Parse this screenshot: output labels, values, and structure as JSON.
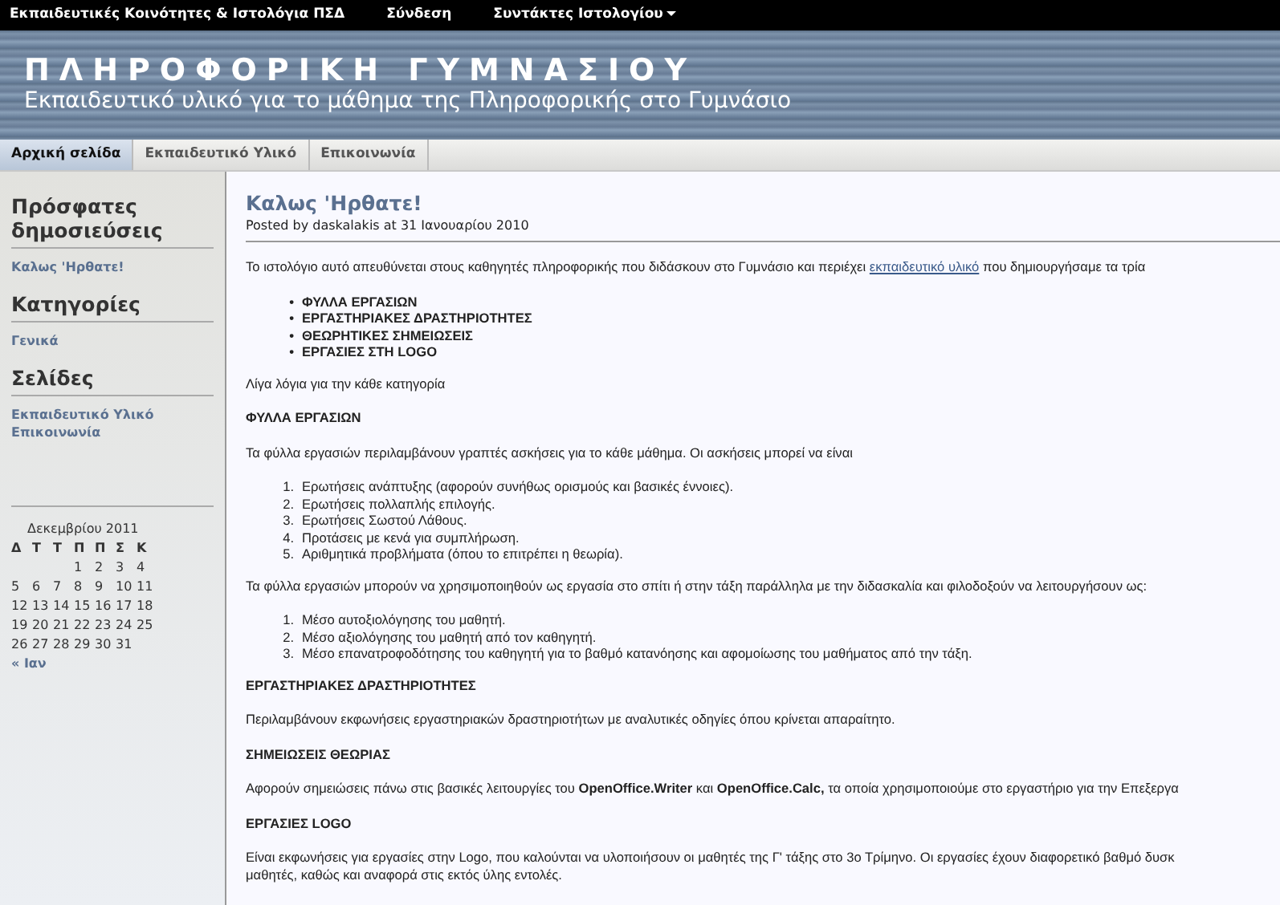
{
  "top_bar": {
    "items": [
      {
        "label": "Εκπαιδευτικές Κοινότητες & Ιστολόγια ΠΣΔ",
        "kind": "title"
      },
      {
        "label": "Σύνδεση",
        "kind": "link"
      },
      {
        "label": "Συντάκτες Ιστολογίου",
        "kind": "menu"
      }
    ]
  },
  "header": {
    "title": "ΠΛΗΡΟΦΟΡΙΚΗ ΓΥΜΝΑΣΙΟΥ",
    "subtitle": "Εκπαιδευτικό υλικό για το μάθημα της Πληροφορικής στο Γυμνάσιο"
  },
  "tabs": [
    {
      "label": "Αρχική σελίδα",
      "selected": true
    },
    {
      "label": "Εκπαιδευτικό Υλικό",
      "selected": false
    },
    {
      "label": "Επικοινωνία",
      "selected": false
    }
  ],
  "sidebar": {
    "sections": [
      {
        "title": "Πρόσφατες δημοσιεύσεις",
        "links": [
          "Καλως 'Ηρθατε!"
        ]
      },
      {
        "title": "Κατηγορίες",
        "links": [
          "Γενικά"
        ]
      },
      {
        "title": "Σελίδες",
        "links": [
          "Εκπαιδευτικό Υλικό",
          "Επικοινωνία"
        ]
      }
    ],
    "calendar": {
      "month": "Δεκεμβρίου 2011",
      "weekdays": [
        "Δ",
        "Τ",
        "Τ",
        "Π",
        "Π",
        "Σ",
        "Κ"
      ],
      "weeks": [
        [
          "1",
          "2",
          "3",
          "4"
        ],
        [
          "5",
          "6",
          "7",
          "8",
          "9",
          "10",
          "11"
        ],
        [
          "12",
          "13",
          "14",
          "15",
          "16",
          "17",
          "18"
        ],
        [
          "19",
          "20",
          "21",
          "22",
          "23",
          "24",
          "25"
        ],
        [
          "26",
          "27",
          "28",
          "29",
          "30",
          "31"
        ]
      ],
      "prev_link": "« Ιαν"
    }
  },
  "post": {
    "title": "Καλως 'Ηρθατε!",
    "byline": "Posted by daskalakis at 31 Ιανουαρίου 2010",
    "body": [
      {
        "kind": "paragraph",
        "parts": [
          {
            "text": "Το ιστολόγιο αυτό απευθύνεται στους καθηγητές πληροφορικής που διδάσκουν  στο Γυμνάσιο και περιέχει",
            "kind": "text"
          },
          {
            "text": "εκπαιδευτικό υλικό",
            "kind": "link"
          },
          {
            "text": "που δημιουργήσαμε τα τρία",
            "kind": "text"
          }
        ]
      },
      {
        "kind": "bullets",
        "items": [
          {
            "marker": "•",
            "text": "ΦΥΛΛΑ ΕΡΓΑΣΙΩΝ"
          },
          {
            "marker": "•",
            "text": "ΕΡΓΑΣΤΗΡΙΑΚΕΣ  ΔΡΑΣΤΗΡΙΟΤΗΤΕΣ"
          },
          {
            "marker": "•",
            "text": "ΘΕΩΡΗΤΙΚΕΣ ΣΗΜΕΙΩΣΕΙΣ"
          },
          {
            "marker": "•",
            "text": "ΕΡΓΑΣΙΕΣ ΣΤΗ LOGO"
          }
        ]
      },
      {
        "kind": "paragraph",
        "parts": [
          {
            "text": "Λίγα λόγια για την κάθε κατηγορία",
            "kind": "text"
          }
        ]
      },
      {
        "kind": "heading",
        "text": "ΦΥΛΛΑ ΕΡΓΑΣΙΩΝ"
      },
      {
        "kind": "paragraph",
        "parts": [
          {
            "text": "Τα φύλλα εργασιών περιλαμβάνουν γραπτές ασκήσεις για το κάθε μάθημα. Οι ασκήσεις μπορεί να είναι",
            "kind": "text"
          }
        ]
      },
      {
        "kind": "numbered",
        "items": [
          {
            "marker": "1.",
            "text": "Ερωτήσεις ανάπτυξης (αφορούν συνήθως ορισμούς και βασικές έννοιες)."
          },
          {
            "marker": "2.",
            "text": "Ερωτήσεις πολλαπλής επιλογής."
          },
          {
            "marker": "3.",
            "text": "Ερωτήσεις Σωστού Λάθους."
          },
          {
            "marker": "4.",
            "text": "Προτάσεις με κενά για συμπλήρωση."
          },
          {
            "marker": "5.",
            "text": "Αριθμητικά προβλήματα (όπου το επιτρέπει η θεωρία)."
          }
        ]
      },
      {
        "kind": "paragraph",
        "parts": [
          {
            "text": "Τα φύλλα εργασιών μπορούν να χρησιμοποιηθούν ως εργασία στο σπίτι ή στην τάξη παράλληλα με την διδασκαλία και φιλοδοξούν να λειτουργήσουν ως:",
            "kind": "text"
          }
        ]
      },
      {
        "kind": "numbered",
        "items": [
          {
            "marker": "1.",
            "text": "Μέσο αυτοξιολόγησης του μαθητή."
          },
          {
            "marker": "2.",
            "text": "Μέσο αξιολόγησης του μαθητή από τον καθηγητή."
          },
          {
            "marker": "3.",
            "text": "Μέσο επανατροφοδότησης του καθηγητή για το βαθμό κατανόησης και αφομοίωσης του μαθήματος από την τάξη."
          }
        ]
      },
      {
        "kind": "heading",
        "text": "ΕΡΓΑΣΤΗΡΙΑΚΕΣ ΔΡΑΣΤΗΡΙΟΤΗΤΕΣ"
      },
      {
        "kind": "paragraph",
        "parts": [
          {
            "text": "Περιλαμβάνουν εκφωνήσεις εργαστηριακών δραστηριοτήτων με αναλυτικές οδηγίες όπου κρίνεται απαραίτητο.",
            "kind": "text"
          }
        ]
      },
      {
        "kind": "heading",
        "text": "ΣΗΜΕΙΩΣΕΙΣ ΘΕΩΡΙΑΣ"
      },
      {
        "kind": "paragraph",
        "parts": [
          {
            "text": "Αφορούν σημειώσεις πάνω στις βασικές λειτουργίες του **OpenOffice.Writer** και **OpenOffice.Calc,** τα οποία χρησιμοποιούμε στο εργαστήριο για την Επεξεργα",
            "kind": "text"
          }
        ]
      },
      {
        "kind": "heading",
        "text": "ΕΡΓΑΣΙΕΣ LOGO"
      },
      {
        "kind": "lines",
        "lines": [
          "Είναι εκφωνήσεις για εργασίες στην Logo, που καλούνται να υλοποιήσουν οι μαθητές της Γ' τάξης στο 3ο Τρίμηνο.  Οι εργασίες έχουν διαφορετικό βαθμό δυσκ",
          "μαθητές, καθώς και αναφορά στις εκτός ύλης εντολές."
        ]
      }
    ]
  }
}
